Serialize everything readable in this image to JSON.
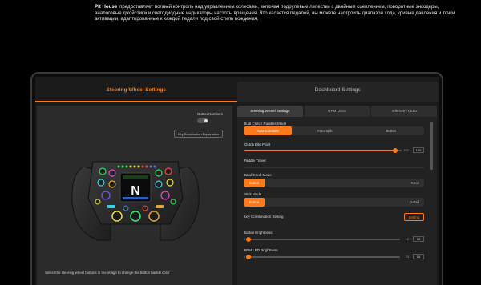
{
  "intro": {
    "brand": "Pit House",
    "text": "предоставляет полный контроль над управлением колесами, включая подрулевые лепестки с двойным сцеплением, поворотные энкодеры, аналоговые джойстики и светодиодные индикаторы частоты вращения. Что касается педалей, вы можете настроить диапазон хода, кривые давления и точки активации, адаптированные к каждой педали под свой стиль вождения."
  },
  "nav": {
    "tab1": "Steering Wheel Settings",
    "tab2": "Dashboard Settings"
  },
  "left": {
    "button_numbers_label": "Button Numbers",
    "key_combination_btn": "Key Combination Explanation",
    "hint": "Select the steering wheel buttons in the image to change the button backlit color",
    "wheel_screen_gear": "N",
    "wheel_screen_top": "2:21.340",
    "wheel_screen_mid": "87",
    "wheel_screen_bottom": "146"
  },
  "right": {
    "subtabs": [
      "Steering Wheel Settings",
      "RPM LEDs",
      "Telemetry LEDs"
    ],
    "dual_clutch": {
      "label": "Dual Clutch Paddles Mode",
      "options": [
        "Auto-Combine",
        "Auto-Split",
        "Button"
      ],
      "selected": 0
    },
    "clutch_bite": {
      "label": "Clutch Bite Point",
      "value_label": "100",
      "value_box": "100",
      "fraction": 0.96
    },
    "paddle_travel": {
      "label": "Paddle Travel"
    },
    "band_knob": {
      "label": "Band Knob Mode",
      "options": [
        "Button",
        "Knob"
      ],
      "selected": 0
    },
    "stick_mode": {
      "label": "Stick Mode",
      "options": [
        "Button",
        "D-Pad"
      ],
      "selected": 0
    },
    "key_combination": {
      "label": "Key Combination Setting",
      "button": "Setting"
    },
    "button_brightness": {
      "label": "Button Brightness",
      "min": "0",
      "max": "15",
      "value_box": "15",
      "fraction": 0.0
    },
    "rpm_brightness": {
      "label": "RPM LED Brightness",
      "min": "0",
      "max": "15",
      "value_box": "15",
      "fraction": 0.0
    }
  },
  "colors": {
    "accent": "#ff7a1a",
    "panel": "#2b2b2b",
    "bg": "#000000"
  }
}
